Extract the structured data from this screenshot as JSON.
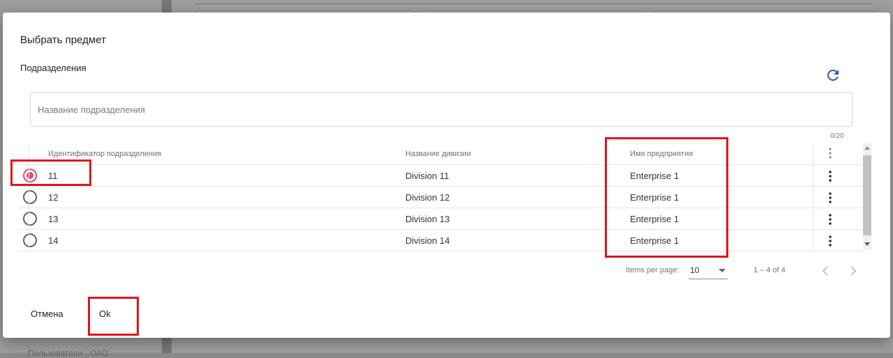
{
  "background": {
    "bottom_text": "Пользователи · ОАО"
  },
  "dialog": {
    "title": "Выбрать предмет",
    "section_label": "Подразделения",
    "refresh_icon": "refresh-icon",
    "search": {
      "placeholder": "Название подразделения",
      "value": "",
      "counter": "0/20"
    },
    "table": {
      "columns": [
        "Идентификатор подразделения",
        "Название дивизии",
        "Имя предприятия"
      ],
      "rows": [
        {
          "id": "11",
          "division": "Division 11",
          "enterprise": "Enterprise 1",
          "selected": true
        },
        {
          "id": "12",
          "division": "Division 12",
          "enterprise": "Enterprise 1",
          "selected": false
        },
        {
          "id": "13",
          "division": "Division 13",
          "enterprise": "Enterprise 1",
          "selected": false
        },
        {
          "id": "14",
          "division": "Division 14",
          "enterprise": "Enterprise 1",
          "selected": false
        }
      ]
    },
    "paginator": {
      "items_per_page_label": "Items per page:",
      "page_size": "10",
      "range_label": "1 – 4 of 4"
    },
    "actions": {
      "cancel_label": "Отмена",
      "ok_label": "Ok"
    }
  },
  "colors": {
    "accent_radio": "#e8497a",
    "refresh_icon": "#3f51b5",
    "annotation": "#e1141c"
  }
}
